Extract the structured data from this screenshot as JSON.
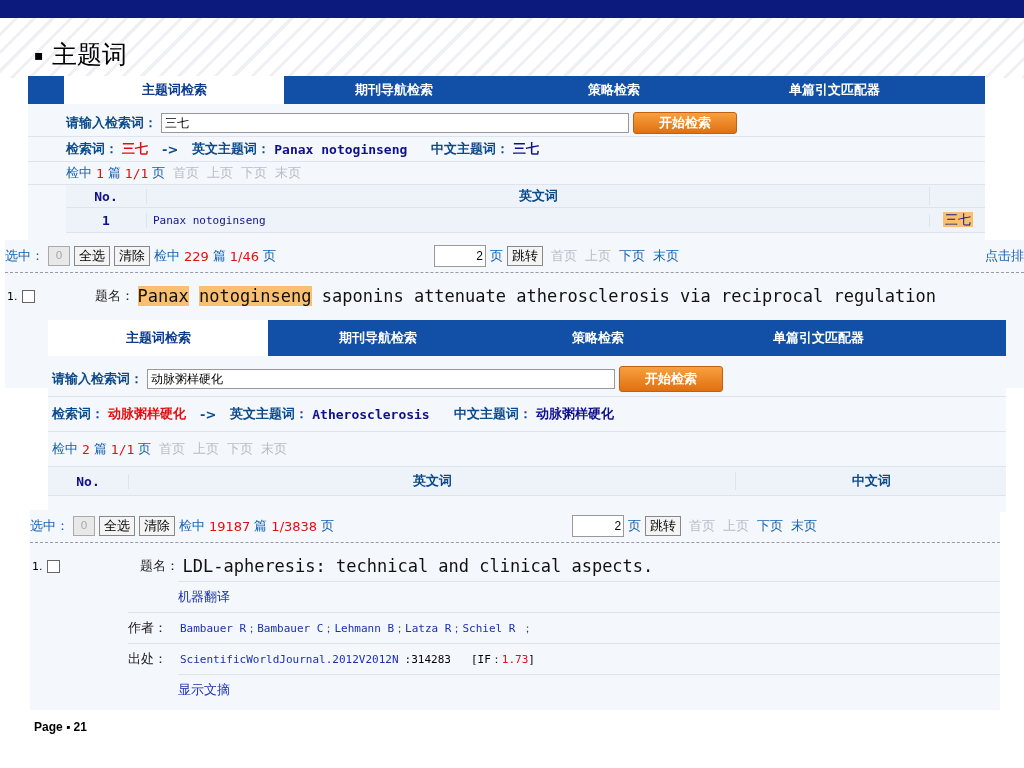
{
  "slide": {
    "bullet": "▪",
    "title": "主题词",
    "footer": "Page ▪ 21"
  },
  "panels": [
    {
      "kind": "search",
      "tabs": [
        {
          "label": "主题词检索",
          "selected": true
        },
        {
          "label": "期刊导航检索",
          "selected": false
        },
        {
          "label": "策略检索",
          "selected": false
        },
        {
          "label": "单篇引文匹配器",
          "selected": false
        }
      ],
      "search_label": "请输入检索词：",
      "query": "三七",
      "button": "开始检索",
      "term_label": "检索词：",
      "term": "三七",
      "arrow": "->",
      "en_label": "英文主题词：",
      "en_term": "Panax notoginseng",
      "cn_label": "中文主题词：",
      "cn_term": "三七",
      "pager": {
        "prefix": "检中",
        "count": "1",
        "unit": "篇",
        "pages": "1/1",
        "suffix": "页",
        "links": [
          {
            "label": "首页",
            "disabled": true
          },
          {
            "label": "上页",
            "disabled": true
          },
          {
            "label": "下页",
            "disabled": true
          },
          {
            "label": "末页",
            "disabled": true
          }
        ]
      },
      "columns": [
        "No.",
        "英文词"
      ],
      "rows": [
        {
          "no": "1",
          "en": "Panax notoginseng",
          "cn": "三七"
        }
      ]
    },
    {
      "kind": "results",
      "selected_label": "选中：",
      "selected_count": "0",
      "buttons": [
        "全选",
        "清除"
      ],
      "pager": {
        "prefix": "检中",
        "count": "229",
        "unit": "篇",
        "pages": "1/46",
        "suffix": "页",
        "links": [
          {
            "label": "首页",
            "disabled": true
          },
          {
            "label": "上页",
            "disabled": true
          },
          {
            "label": "下页",
            "disabled": false
          },
          {
            "label": "末页",
            "disabled": false
          }
        ]
      },
      "page_input": "2",
      "page_unit": "页",
      "jump": "跳转",
      "sort": "点击排",
      "items": [
        {
          "index": "1.",
          "checked": false,
          "title_label": "题名：",
          "title": [
            {
              "text": "Panax",
              "highlight": true
            },
            {
              "text": "notoginseng",
              "highlight": true
            },
            {
              "text": "saponins attenuate atherosclerosis via reciprocal regulation",
              "highlight": false
            }
          ]
        }
      ]
    },
    {
      "kind": "search",
      "tabs": [
        {
          "label": "主题词检索",
          "selected": true
        },
        {
          "label": "期刊导航检索",
          "selected": false
        },
        {
          "label": "策略检索",
          "selected": false
        },
        {
          "label": "单篇引文匹配器",
          "selected": false
        }
      ],
      "search_label": "请输入检索词：",
      "query": "动脉粥样硬化",
      "button": "开始检索",
      "term_label": "检索词：",
      "term": "动脉粥样硬化",
      "arrow": "->",
      "en_label": "英文主题词：",
      "en_term": "Atherosclerosis",
      "cn_label": "中文主题词：",
      "cn_term": "动脉粥样硬化",
      "pager": {
        "prefix": "检中",
        "count": "2",
        "unit": "篇",
        "pages": "1/1",
        "suffix": "页",
        "links": [
          {
            "label": "首页",
            "disabled": true
          },
          {
            "label": "上页",
            "disabled": true
          },
          {
            "label": "下页",
            "disabled": true
          },
          {
            "label": "末页",
            "disabled": true
          }
        ]
      },
      "columns": [
        "No.",
        "英文词",
        "中文词"
      ]
    },
    {
      "kind": "results",
      "selected_label": "选中：",
      "selected_count": "0",
      "buttons": [
        "全选",
        "清除"
      ],
      "pager": {
        "prefix": "检中",
        "count": "19187",
        "unit": "篇",
        "pages": "1/3838",
        "suffix": "页",
        "links": [
          {
            "label": "首页",
            "disabled": true
          },
          {
            "label": "上页",
            "disabled": true
          },
          {
            "label": "下页",
            "disabled": false
          },
          {
            "label": "末页",
            "disabled": false
          }
        ]
      },
      "page_input": "2",
      "page_unit": "页",
      "jump": "跳转",
      "items": [
        {
          "index": "1.",
          "checked": false,
          "title_label": "题名：",
          "title": [
            {
              "text": "LDL-apheresis: technical and clinical aspects.",
              "highlight": false
            }
          ],
          "translate": "机器翻译",
          "author_label": "作者：",
          "authors": "Bambauer R；Bambauer C；Lehmann B；Latza R；Schiel R ；",
          "source_label": "出处：",
          "source": "ScientificWorldJournal.2012V2012N",
          "source_extra": ":314283",
          "if_label": "[IF：",
          "if_value": "1.73",
          "if_end": "]",
          "abstract": "显示文摘"
        }
      ]
    }
  ]
}
